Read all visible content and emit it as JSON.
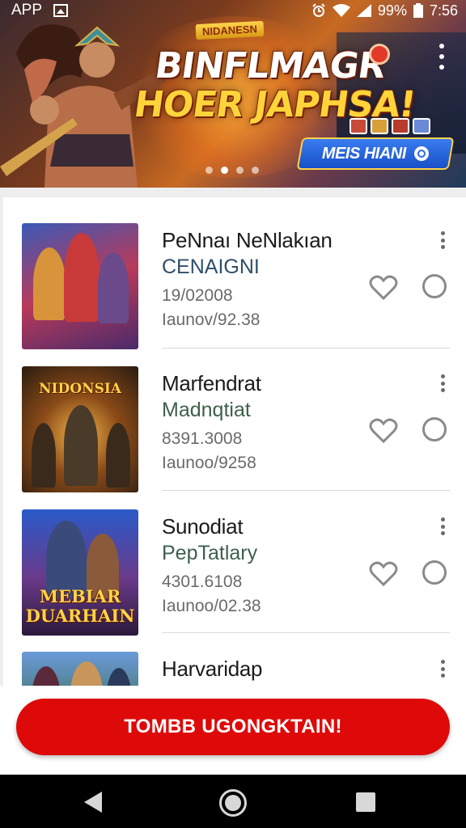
{
  "status_bar": {
    "app_label": "APP",
    "battery": "99%",
    "time": "7:56"
  },
  "banner": {
    "chip": "NIDANESN",
    "title_line1": "BINFLMAGR",
    "title_line2": "HOER JAPHSA!",
    "cta_label": "MEIS HIANI",
    "active_dot": 1,
    "dot_count": 4
  },
  "list": {
    "items": [
      {
        "title": "PeNnaı NeNlakıan",
        "subtitle": "CENAIGNI",
        "line3": "19/02008",
        "line4": "Iaunov/92.38",
        "thumb_label": ""
      },
      {
        "title": "Marfendrat",
        "subtitle": "Madnqtiat",
        "line3": "8391.3008",
        "line4": "Iaunoo/9258",
        "thumb_label": "NIDONSIA"
      },
      {
        "title": "Sunodiat",
        "subtitle": "PepTatlary",
        "line3": "4301.6108",
        "line4": "Iaunoo/02.38",
        "thumb_label": "MEBIAR DUARHAIN"
      },
      {
        "title": "Harvaridap",
        "subtitle": "",
        "line3": "",
        "line4": "",
        "thumb_label": ""
      }
    ]
  },
  "primary_button": {
    "label": "TOMBB UGONGKTAIN!"
  },
  "colors": {
    "primary_red": "#de0a0a",
    "banner_cta_blue": "#2d69e2",
    "subtitle_green": "#3e5f4d"
  }
}
